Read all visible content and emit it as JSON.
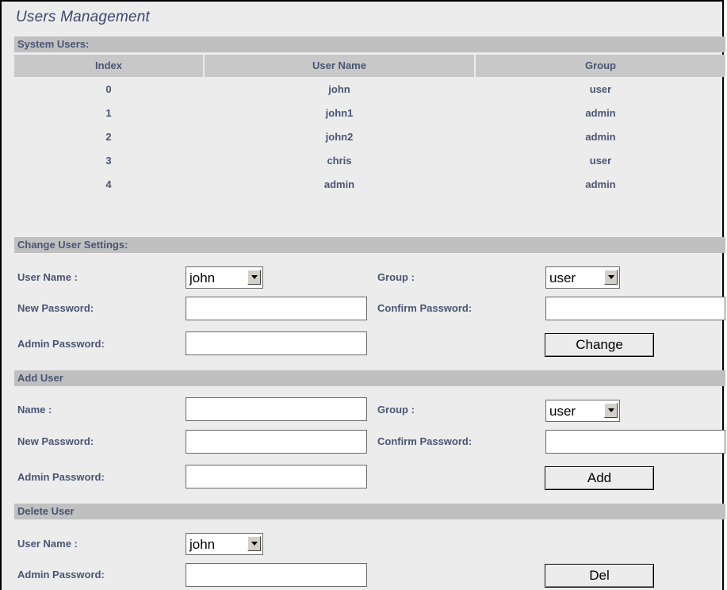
{
  "title": "Users Management",
  "system_users": {
    "section_label": "System Users:",
    "columns": [
      "Index",
      "User Name",
      "Group"
    ],
    "rows": [
      {
        "index": "0",
        "user": "john",
        "group": "user"
      },
      {
        "index": "1",
        "user": "john1",
        "group": "admin"
      },
      {
        "index": "2",
        "user": "john2",
        "group": "admin"
      },
      {
        "index": "3",
        "user": "chris",
        "group": "user"
      },
      {
        "index": "4",
        "user": "admin",
        "group": "admin"
      }
    ]
  },
  "change_user": {
    "section_label": "Change User Settings:",
    "user_name_label": "User Name :",
    "user_name_value": "john",
    "group_label": "Group :",
    "group_value": "user",
    "new_password_label": "New Password:",
    "confirm_password_label": "Confirm Password:",
    "admin_password_label": "Admin Password:",
    "button_label": "Change"
  },
  "add_user": {
    "section_label": "Add User",
    "name_label": "Name :",
    "group_label": "Group :",
    "group_value": "user",
    "new_password_label": "New Password:",
    "confirm_password_label": "Confirm Password:",
    "admin_password_label": "Admin Password:",
    "button_label": "Add"
  },
  "delete_user": {
    "section_label": "Delete User",
    "user_name_label": "User Name :",
    "user_name_value": "john",
    "admin_password_label": "Admin Password:",
    "button_label": "Del"
  }
}
